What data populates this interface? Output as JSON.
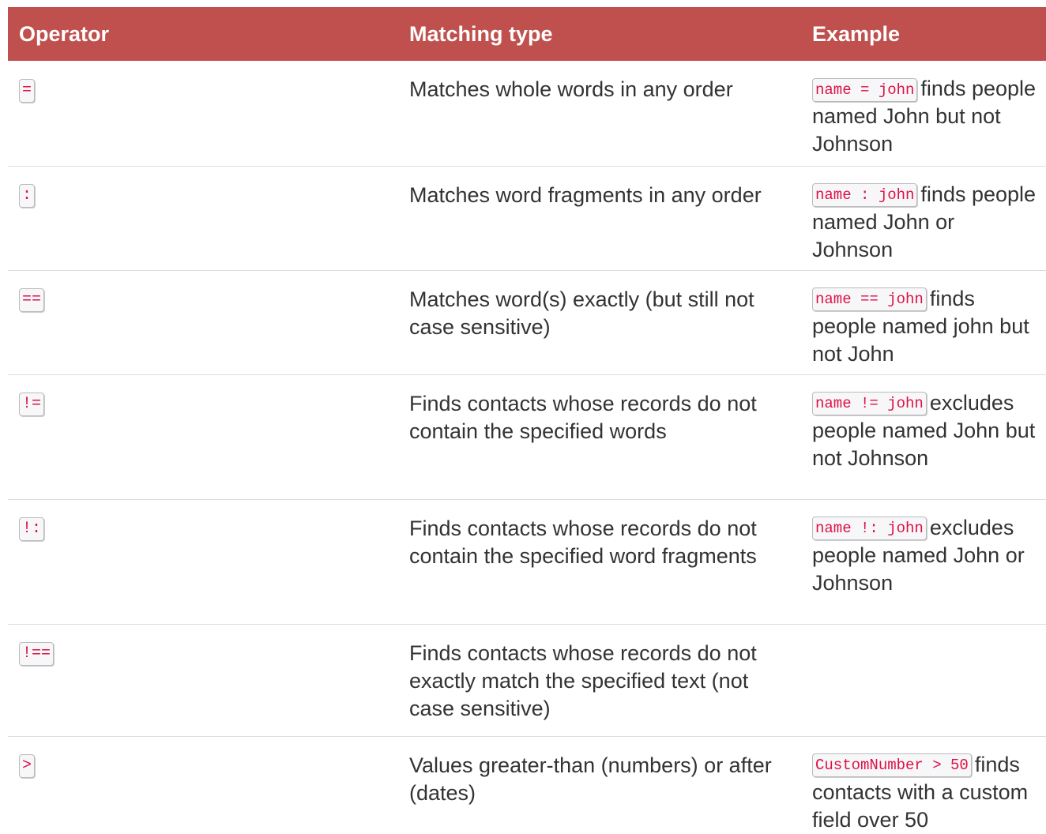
{
  "table": {
    "headers": {
      "operator": "Operator",
      "matching_type": "Matching type",
      "example": "Example"
    },
    "rows": [
      {
        "operator": "=",
        "matching_type": "Matches whole words in any order",
        "example_code": "name = john",
        "example_text": "finds people named John but not Johnson"
      },
      {
        "operator": ":",
        "matching_type": "Matches word fragments in any order",
        "example_code": "name : john",
        "example_text": "finds people named John or Johnson"
      },
      {
        "operator": "==",
        "matching_type": "Matches word(s) exactly (but still not case sensitive)",
        "example_code": "name == john",
        "example_text": "finds people named john but not John"
      },
      {
        "operator": "!=",
        "matching_type": "Finds contacts whose records do not contain the specified words",
        "example_code": "name != john",
        "example_text": "excludes people named John but not Johnson"
      },
      {
        "operator": "!:",
        "matching_type": "Finds contacts whose records do not contain the specified word fragments",
        "example_code": "name !: john",
        "example_text": "excludes people named John or Johnson"
      },
      {
        "operator": "!==",
        "matching_type": "Finds contacts whose records do not exactly match the specified text (not case sensitive)",
        "example_code": "",
        "example_text": ""
      },
      {
        "operator": ">",
        "matching_type": "Values greater-than (numbers) or after (dates)",
        "example_code": "CustomNumber > 50",
        "example_text": "finds contacts with a custom field over 50"
      }
    ]
  },
  "colors": {
    "header_background": "#c0504d",
    "header_text": "#ffffff",
    "body_text": "#333333",
    "code_text": "#dd1144",
    "code_background": "#f7f7f9",
    "row_divider": "#dddddd"
  }
}
